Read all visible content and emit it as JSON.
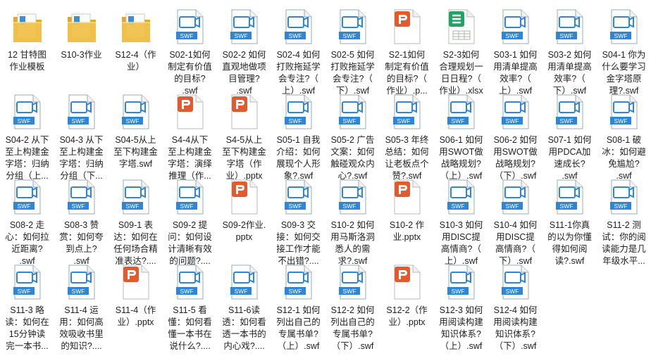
{
  "files": [
    {
      "type": "folder",
      "label": "12 甘特图\n作业模板"
    },
    {
      "type": "folder",
      "label": "S10-3作业"
    },
    {
      "type": "folder",
      "label": "S12-4（作\n业）"
    },
    {
      "type": "swf",
      "label": "S02-1如何\n制定有价值\n的目标?\n.swf"
    },
    {
      "type": "swf",
      "label": "S02-2 如何\n直观地做项\n目管理?\n.swf"
    },
    {
      "type": "swf",
      "label": "S02-4 如何\n打败拖延学\n会专注?（\n上）.swf"
    },
    {
      "type": "swf",
      "label": "S02-5 如何\n打败拖延学\n会专注?（\n下）.swf"
    },
    {
      "type": "pptx",
      "label": "S2-1如何\n制定有价值\n的目标?（\n作业）.p..."
    },
    {
      "type": "xlsx",
      "label": "S2-3如何\n合理规划一\n日日程?（\n作业）.xlsx"
    },
    {
      "type": "swf",
      "label": "S03-1 如何\n用清单提高\n效率?（\n上）.swf"
    },
    {
      "type": "swf",
      "label": "S03-2 如何\n用清单提高\n效率?（\n下）.swf"
    },
    {
      "type": "swf",
      "label": "S04-1 你为\n什么要学习\n金字塔原\n理?.swf"
    },
    {
      "type": "swf",
      "label": "S04-2 从下\n至上构建金\n字塔：归纳\n分组（上..."
    },
    {
      "type": "swf",
      "label": "S04-3 从下\n至上构建金\n字塔：归纳\n分组（下..."
    },
    {
      "type": "swf",
      "label": "S04-5从上\n至下构建金\n字塔.swf"
    },
    {
      "type": "pptx",
      "label": "S4-4从下\n至上构建金\n字塔：演绎\n推理（作..."
    },
    {
      "type": "pptx",
      "label": "S4-5从上\n至下构建金\n字塔（作\n业）.pptx"
    },
    {
      "type": "swf",
      "label": "S05-1 自我\n介绍：如何\n展现个人形\n象?.swf"
    },
    {
      "type": "swf",
      "label": "S05-2 广告\n文案：如何\n触碰观众内\n心?.swf"
    },
    {
      "type": "swf",
      "label": "S05-3 年终\n总结：如何\n让老板点个\n赞?.swf"
    },
    {
      "type": "swf",
      "label": "S06-1 如何\n用SWOT做\n战略规划?\n（上）.swf"
    },
    {
      "type": "swf",
      "label": "S06-2 如何\n用SWOT做\n战略规划?\n（下）.swf"
    },
    {
      "type": "swf",
      "label": "S07-1 如何\n用PDCA加\n速成长?\n.swf"
    },
    {
      "type": "swf",
      "label": "S08-1 破\n冰：如何避\n免尴尬?\n.swf"
    },
    {
      "type": "swf",
      "label": "S08-2 走\n心：如何拉\n近距离?\n.swf"
    },
    {
      "type": "swf",
      "label": "S08-3 赞\n赏：如何夸\n到点上?\n.swf"
    },
    {
      "type": "swf",
      "label": "S09-1 表\n达：如何在\n任何场合精\n准表达?...."
    },
    {
      "type": "swf",
      "label": "S09-2 提\n问：如何设\n计清晰有效\n的问题?...."
    },
    {
      "type": "pptx",
      "label": "S09-2作业.\npptx"
    },
    {
      "type": "swf",
      "label": "S09-3 交\n接：如何交\n接工作才能\n不出错?...."
    },
    {
      "type": "swf",
      "label": "S10-2 如何\n用马斯洛洞\n悉人的需\n求?.swf"
    },
    {
      "type": "pptx",
      "label": "S10-2 作\n业.pptx"
    },
    {
      "type": "swf",
      "label": "S10-3 如何\n用DISC提\n高情商?（\n上）.swf"
    },
    {
      "type": "swf",
      "label": "S10-4 如何\n用DISC提\n高情商?（\n下）.swf"
    },
    {
      "type": "swf",
      "label": "S11-1你真\n的以为你懂\n得如何阅\n读?.swf"
    },
    {
      "type": "swf",
      "label": "S11-2 测\n试：你的阅\n读能力是几\n年级水平..."
    },
    {
      "type": "swf",
      "label": "S11-3 略\n读：如何在\n15分钟读\n完一本书..."
    },
    {
      "type": "swf",
      "label": "S11-4 运\n用：如何高\n效吸收书里\n的知识?...."
    },
    {
      "type": "pptx",
      "label": "S11-4（作\n业）.pptx"
    },
    {
      "type": "swf",
      "label": "S11-5 看\n懂：如何看\n懂一本书在\n说什么?...."
    },
    {
      "type": "swf",
      "label": "S11-6读\n透：如何看\n透一本书的\n内心戏?...."
    },
    {
      "type": "swf",
      "label": "S12-1 如何\n列出自己的\n专属书单?\n（上）.swf"
    },
    {
      "type": "swf",
      "label": "S12-2 如何\n列出自己的\n专属书单?\n（下）.swf"
    },
    {
      "type": "pptx",
      "label": "S12-2（作\n业）.pptx"
    },
    {
      "type": "swf",
      "label": "S12-3 如何\n用阅读构建\n知识体系?\n（上）.swf"
    },
    {
      "type": "swf",
      "label": "S12-4 如何\n用阅读构建\n知识体系?\n（下）.swf"
    }
  ],
  "icon_badge_text": {
    "swf": "SWF"
  },
  "colors": {
    "swf": "#2f86d6",
    "pptx": "#e25a2d",
    "xlsx": "#21a366",
    "folder": "#f0c14b"
  }
}
